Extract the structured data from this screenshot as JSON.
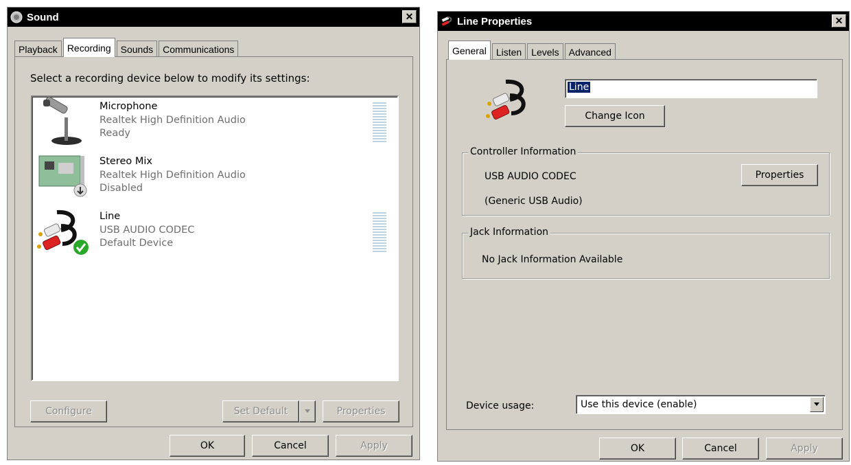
{
  "sound_window": {
    "title": "Sound",
    "close_glyph": "✕",
    "tabs": [
      {
        "label": "Playback"
      },
      {
        "label": "Recording"
      },
      {
        "label": "Sounds"
      },
      {
        "label": "Communications"
      }
    ],
    "active_tab": "Recording",
    "instruction": "Select a recording device below to modify its settings:",
    "devices": [
      {
        "name": "Microphone",
        "driver": "Realtek High Definition Audio",
        "status": "Ready",
        "icon": "microphone-icon"
      },
      {
        "name": "Stereo Mix",
        "driver": "Realtek High Definition Audio",
        "status": "Disabled",
        "icon": "sound-card-icon"
      },
      {
        "name": "Line",
        "driver": "USB AUDIO  CODEC",
        "status": "Default Device",
        "icon": "rca-cable-icon"
      }
    ],
    "buttons": {
      "configure": "Configure",
      "set_default": "Set Default",
      "properties": "Properties",
      "ok": "OK",
      "cancel": "Cancel",
      "apply": "Apply"
    }
  },
  "line_window": {
    "title": "Line Properties",
    "close_glyph": "✕",
    "tabs": [
      {
        "label": "General"
      },
      {
        "label": "Listen"
      },
      {
        "label": "Levels"
      },
      {
        "label": "Advanced"
      }
    ],
    "active_tab": "General",
    "device_name_value": "Line",
    "change_icon_label": "Change Icon",
    "controller_group": {
      "legend": "Controller Information",
      "line1": "USB AUDIO  CODEC",
      "line2": "(Generic USB Audio)",
      "properties_label": "Properties"
    },
    "jack_group": {
      "legend": "Jack Information",
      "text": "No Jack Information Available"
    },
    "device_usage_label": "Device usage:",
    "device_usage_value": "Use this device (enable)",
    "buttons": {
      "ok": "OK",
      "cancel": "Cancel",
      "apply": "Apply"
    }
  },
  "colors": {
    "window_face": "#d4d0c8",
    "title_bar": "#000000",
    "selection": "#0a246a",
    "meter": "#b9d3e2",
    "default_check": "#2aa82a"
  }
}
